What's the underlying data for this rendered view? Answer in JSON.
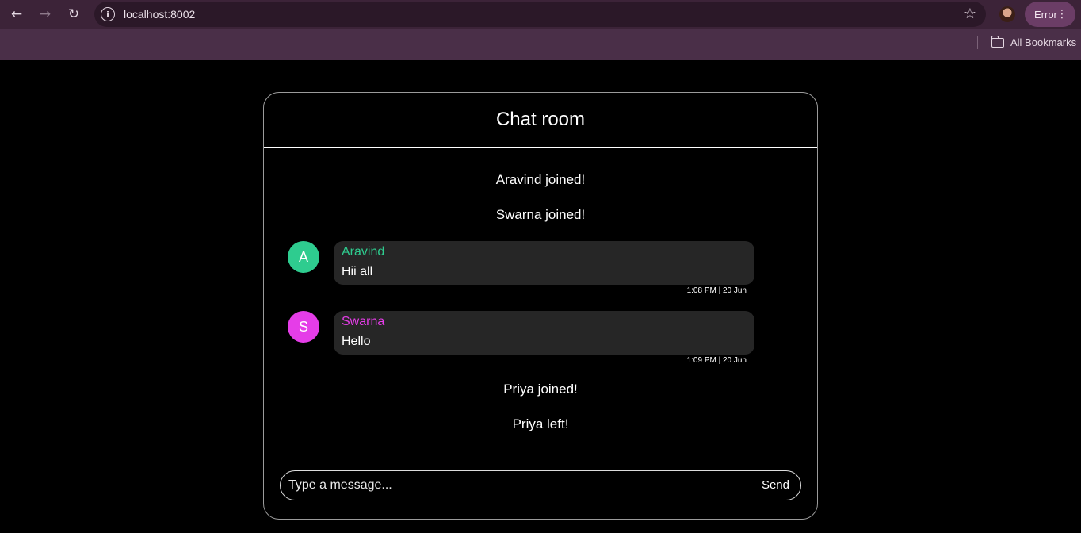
{
  "browser": {
    "url": "localhost:8002",
    "profile_status": "Error",
    "bookmarks_label": "All Bookmarks",
    "icons": [
      "back-icon",
      "forward-icon",
      "reload-icon",
      "site-info-icon",
      "bookmark-star-icon",
      "profile-avatar",
      "more-icon",
      "folder-icon"
    ]
  },
  "chat": {
    "title": "Chat room",
    "events": [
      {
        "type": "system",
        "text": "Aravind joined!"
      },
      {
        "type": "system",
        "text": "Swarna joined!"
      },
      {
        "type": "message",
        "initial": "A",
        "sender": "Aravind",
        "text": "Hii all",
        "time": "1:08 PM | 20 Jun",
        "color": "#2ecc8f"
      },
      {
        "type": "message",
        "initial": "S",
        "sender": "Swarna",
        "text": "Hello",
        "time": "1:09 PM | 20 Jun",
        "color": "#e53de8"
      },
      {
        "type": "system",
        "text": "Priya joined!"
      },
      {
        "type": "system",
        "text": "Priya left!"
      }
    ],
    "input": {
      "placeholder": "Type a message...",
      "value": ""
    },
    "send_label": "Send"
  }
}
